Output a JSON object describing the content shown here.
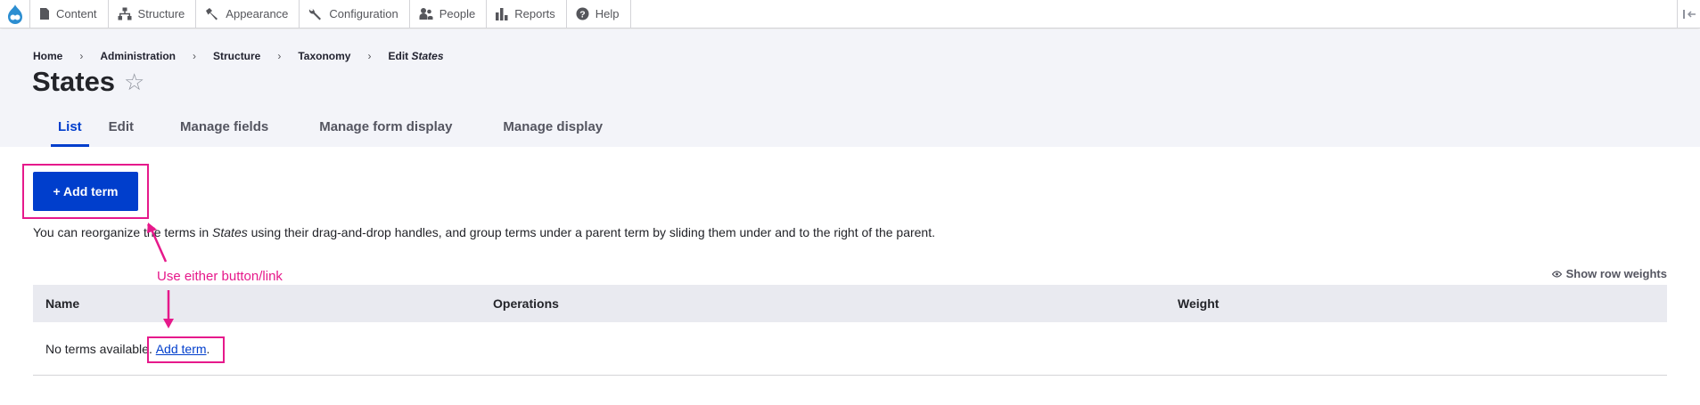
{
  "toolbar": {
    "items": [
      {
        "label": "Content",
        "icon": "document-icon"
      },
      {
        "label": "Structure",
        "icon": "sitemap-icon"
      },
      {
        "label": "Appearance",
        "icon": "paintbrush-icon"
      },
      {
        "label": "Configuration",
        "icon": "wrench-icon"
      },
      {
        "label": "People",
        "icon": "people-icon"
      },
      {
        "label": "Reports",
        "icon": "bar-chart-icon"
      },
      {
        "label": "Help",
        "icon": "help-icon"
      }
    ]
  },
  "breadcrumb": {
    "home": "Home",
    "administration": "Administration",
    "structure": "Structure",
    "taxonomy": "Taxonomy",
    "edit_prefix": "Edit",
    "edit_name": "States",
    "separator": "›"
  },
  "page": {
    "title": "States",
    "star": "☆"
  },
  "tabs": [
    "List",
    "Edit",
    "Manage fields",
    "Manage form display",
    "Manage display"
  ],
  "main": {
    "add_button": "+ Add term",
    "desc_before": "You can reorganize the terms in",
    "desc_vocab": "States",
    "desc_after": "using their drag-and-drop handles, and group terms under a parent term by sliding them under and to the right of the parent.",
    "row_weights": "Show row weights",
    "table": {
      "headers": [
        "Name",
        "Operations",
        "Weight"
      ],
      "empty_text": "No terms available.",
      "empty_link": "Add term",
      "empty_suffix": "."
    }
  },
  "annotation": {
    "label": "Use either button/link",
    "color": "#e6198b"
  },
  "colors": {
    "accent": "#003ecc",
    "header_bg": "#f3f4f9",
    "annotation": "#e6198b"
  }
}
